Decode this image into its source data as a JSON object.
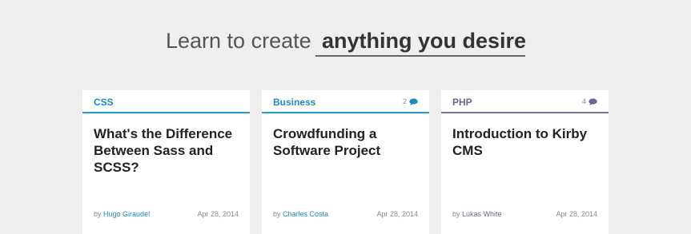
{
  "hero": {
    "prefix": "Learn to create",
    "selected": "anything you desire"
  },
  "colors": {
    "css_accent": "#2499c7",
    "business_accent": "#2499c7",
    "php_accent": "#7b73a3"
  },
  "cards": [
    {
      "category": "CSS",
      "comment_count": "",
      "title": "What's the Difference Between Sass and SCSS?",
      "by": "by",
      "author": "Hugo Giraudel",
      "date": "Apr 28, 2014"
    },
    {
      "category": "Business",
      "comment_count": "2",
      "title": "Crowdfunding a Software Project",
      "by": "by",
      "author": "Charles Costa",
      "date": "Apr 28, 2014"
    },
    {
      "category": "PHP",
      "comment_count": "4",
      "title": "Introduction to Kirby CMS",
      "by": "by",
      "author": "Lukas White",
      "date": "Apr 28, 2014"
    }
  ]
}
